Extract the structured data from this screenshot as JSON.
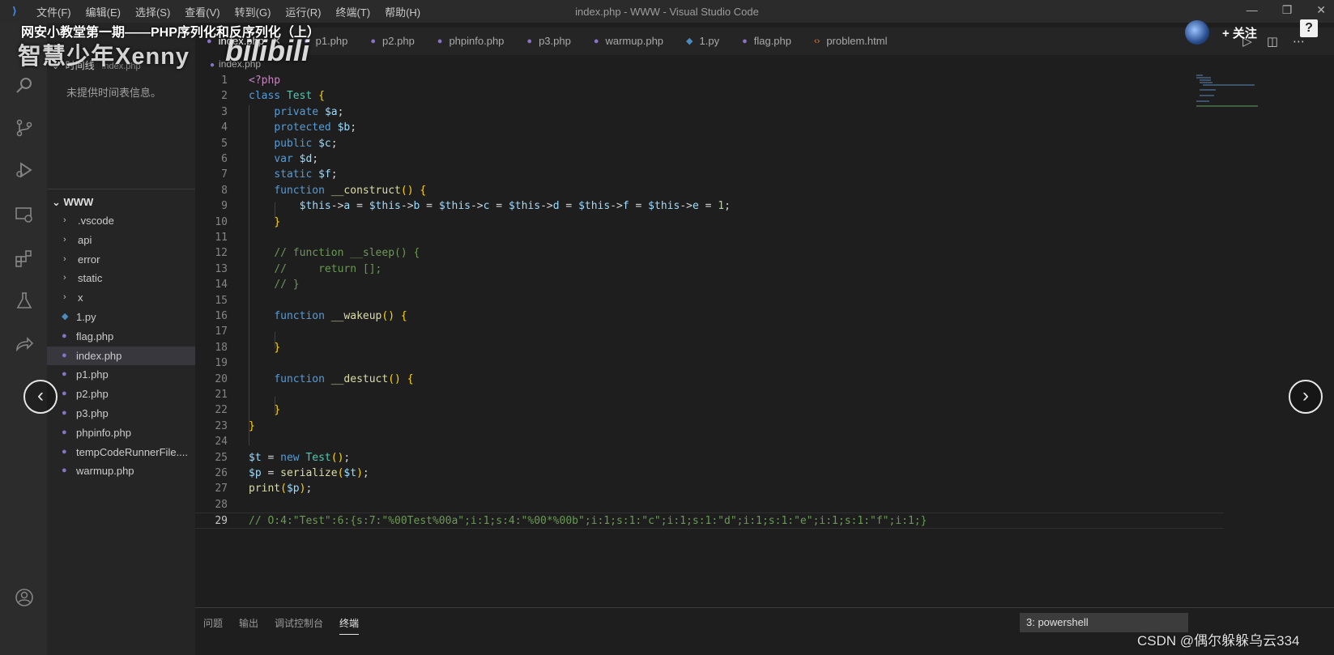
{
  "window": {
    "title": "index.php - WWW - Visual Studio Code",
    "menu": [
      "文件(F)",
      "编辑(E)",
      "选择(S)",
      "查看(V)",
      "转到(G)",
      "运行(R)",
      "终端(T)",
      "帮助(H)"
    ]
  },
  "overlay": {
    "video_title": "网安小教堂第一期——PHP序列化和反序列化（上）",
    "brand": "智慧少年Xenny",
    "bili": "bilibili",
    "follow": "+ 关注",
    "help": "?",
    "watermark": "CSDN @偶尔躲躲乌云334"
  },
  "sidebar": {
    "timeline_label": "时间线",
    "timeline_file": "index.php",
    "timeline_empty": "未提供时间表信息。",
    "root_folder": "WWW",
    "folders": [
      ".vscode",
      "api",
      "error",
      "static",
      "x"
    ],
    "files": [
      {
        "name": "1.py",
        "type": "py"
      },
      {
        "name": "flag.php",
        "type": "php"
      },
      {
        "name": "index.php",
        "type": "php",
        "selected": true
      },
      {
        "name": "p1.php",
        "type": "php"
      },
      {
        "name": "p2.php",
        "type": "php"
      },
      {
        "name": "p3.php",
        "type": "php"
      },
      {
        "name": "phpinfo.php",
        "type": "php"
      },
      {
        "name": "tempCodeRunnerFile....",
        "type": "php"
      },
      {
        "name": "warmup.php",
        "type": "php"
      }
    ]
  },
  "tabs": [
    {
      "label": "index.php",
      "type": "php",
      "active": true
    },
    {
      "label": "p1.php",
      "type": "php"
    },
    {
      "label": "p2.php",
      "type": "php"
    },
    {
      "label": "phpinfo.php",
      "type": "php"
    },
    {
      "label": "p3.php",
      "type": "php"
    },
    {
      "label": "warmup.php",
      "type": "php"
    },
    {
      "label": "1.py",
      "type": "py"
    },
    {
      "label": "flag.php",
      "type": "php"
    },
    {
      "label": "problem.html",
      "type": "html"
    }
  ],
  "breadcrumb": "index.php",
  "editor": {
    "lines": [
      "<?php",
      "class Test {",
      "    private $a;",
      "    protected $b;",
      "    public $c;",
      "    var $d;",
      "    static $f;",
      "    function __construct() {",
      "        $this->a = $this->b = $this->c = $this->d = $this->f = $this->e = 1;",
      "    }",
      "",
      "    // function __sleep() {",
      "    //     return [];",
      "    // }",
      "",
      "    function __wakeup() {",
      "",
      "    }",
      "",
      "    function __destuct() {",
      "",
      "    }",
      "}",
      "",
      "$t = new Test();",
      "$p = serialize($t);",
      "print($p);",
      "",
      "// O:4:\"Test\":6:{s:7:\"%00Test%00a\";i:1;s:4:\"%00*%00b\";i:1;s:1:\"c\";i:1;s:1:\"d\";i:1;s:1:\"e\";i:1;s:1:\"f\";i:1;}"
    ],
    "current_line": 29
  },
  "panel": {
    "tabs": [
      "问题",
      "输出",
      "调试控制台",
      "终端"
    ],
    "active_tab": "终端",
    "terminal_select": "3: powershell"
  }
}
